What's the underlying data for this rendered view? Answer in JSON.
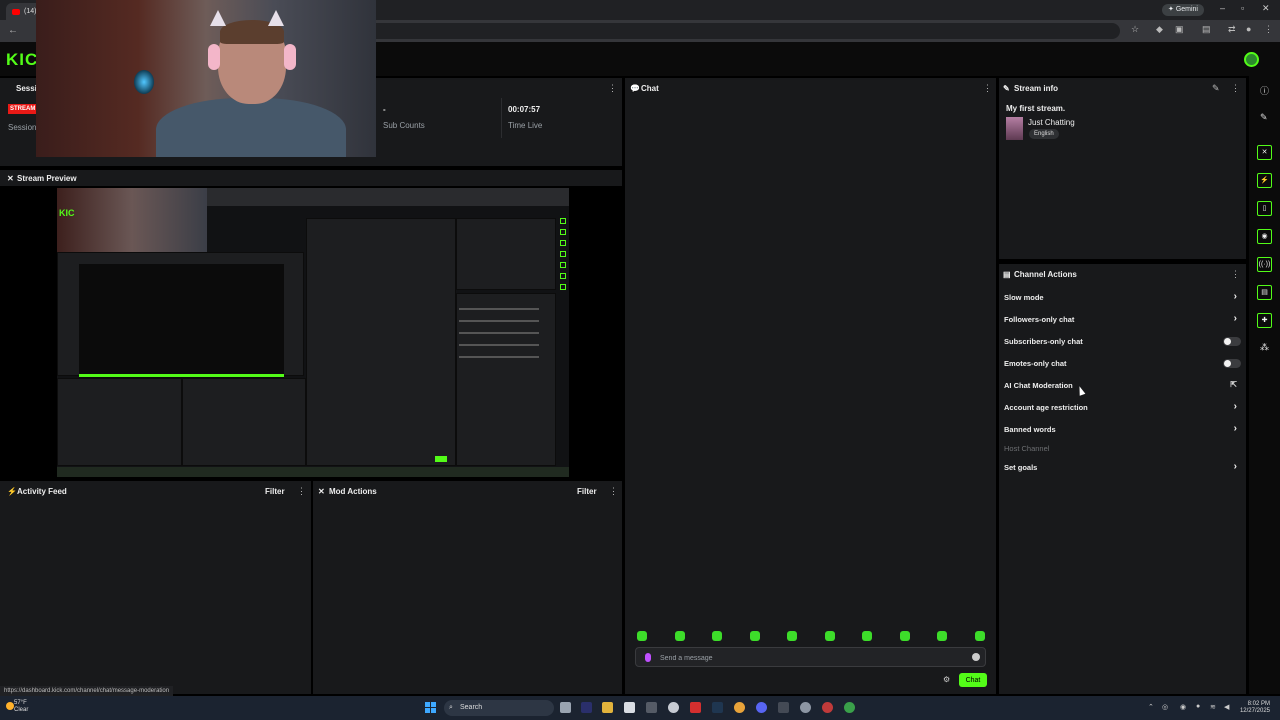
{
  "browser": {
    "tab_title": "(14) I",
    "gemini_label": "Gemini"
  },
  "session_panel": {
    "title": "Sessi",
    "stream_badge": "STREAM",
    "session_label": "Session",
    "sub_counts_value": "-",
    "sub_counts_label": "Sub Counts",
    "time_live_value": "00:07:57",
    "time_live_label": "Time Live"
  },
  "stream_preview": {
    "title": "Stream Preview"
  },
  "chat_panel": {
    "title": "Chat",
    "input_placeholder": "Send a message",
    "send_label": "Chat"
  },
  "stream_info": {
    "title": "Stream info",
    "stream_title": "My first stream.",
    "category": "Just Chatting",
    "language": "English"
  },
  "channel_actions": {
    "title": "Channel Actions",
    "items": [
      {
        "label": "Slow mode",
        "control": "chevron"
      },
      {
        "label": "Followers-only chat",
        "control": "chevron"
      },
      {
        "label": "Subscribers-only chat",
        "control": "toggle"
      },
      {
        "label": "Emotes-only chat",
        "control": "toggle"
      },
      {
        "label": "AI Chat Moderation",
        "control": "external"
      },
      {
        "label": "Account age restriction",
        "control": "chevron"
      },
      {
        "label": "Banned words",
        "control": "chevron"
      },
      {
        "label": "Host Channel",
        "control": "none"
      },
      {
        "label": "Set goals",
        "control": "chevron"
      }
    ]
  },
  "activity_feed": {
    "title": "Activity Feed",
    "filter_label": "Filter"
  },
  "mod_actions": {
    "title": "Mod Actions",
    "filter_label": "Filter"
  },
  "status_url": "https://dashboard.kick.com/channel/chat/message-moderation",
  "taskbar": {
    "weather_temp": "57°F",
    "weather_desc": "Clear",
    "search_label": "Search",
    "time": "8:02 PM",
    "date": "12/27/2025"
  },
  "colors": {
    "accent": "#53fc18",
    "panel": "#18191b",
    "background": "#000000",
    "badge_red": "#e91916"
  }
}
